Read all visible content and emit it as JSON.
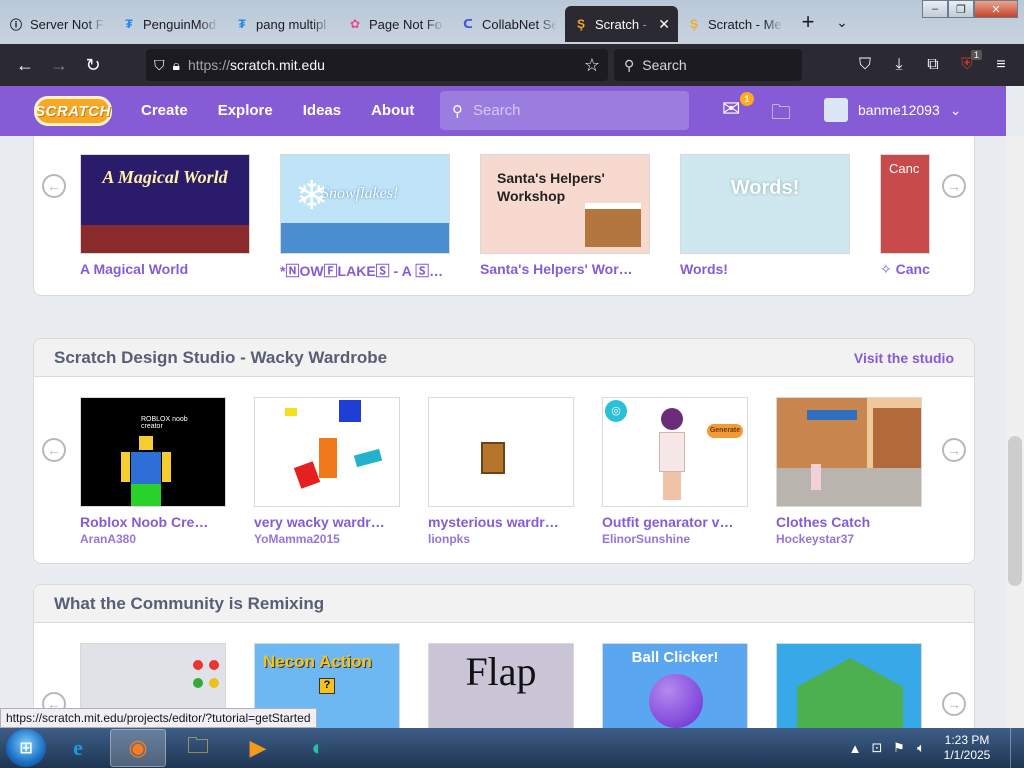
{
  "browser": {
    "tabs": [
      {
        "label": "Server Not Fo",
        "icon": "info-icon",
        "active": false
      },
      {
        "label": "PenguinMod",
        "icon": "penguinmod-icon",
        "active": false
      },
      {
        "label": "pang multipl",
        "icon": "penguinmod-icon",
        "active": false
      },
      {
        "label": "Page Not Fo",
        "icon": "flower-icon",
        "active": false
      },
      {
        "label": "CollabNet Se",
        "icon": "collabnet-icon",
        "active": false
      },
      {
        "label": "Scratch - I",
        "icon": "scratch-cat-icon",
        "active": true
      },
      {
        "label": "Scratch - Me",
        "icon": "scratch-cat-icon",
        "active": false
      }
    ],
    "url": {
      "protocol": "https://",
      "host": "scratch.mit.edu",
      "path": ""
    },
    "search_placeholder": "Search",
    "ublock_badge": "1"
  },
  "header": {
    "logo": "SCRATCH",
    "nav": [
      "Create",
      "Explore",
      "Ideas",
      "About"
    ],
    "search_placeholder": "Search",
    "messages_count": "1",
    "username": "banme12093"
  },
  "sections": [
    {
      "title": "",
      "link": "",
      "cards": [
        {
          "title": "A Magical World",
          "author": "",
          "thumb_text": "A Magical World",
          "bg": "#2a1c6b"
        },
        {
          "title": "*🄽OW🄵LAKE🅂 - A 🅂T…",
          "author": "",
          "thumb_text": "Snowflakes!",
          "bg": "#bfe3f7"
        },
        {
          "title": "Santa's Helpers' Wor…",
          "author": "",
          "thumb_text": "Santa's Helpers' Workshop",
          "bg": "#f8d9d0"
        },
        {
          "title": "Words!",
          "author": "",
          "thumb_text": "Words!",
          "bg": "#cfe8f0"
        },
        {
          "title": "✧ Canc",
          "author": "",
          "thumb_text": "Canc",
          "bg": "#c94a4a"
        }
      ]
    },
    {
      "title": "Scratch Design Studio - Wacky Wardrobe",
      "link": "Visit the studio",
      "cards": [
        {
          "title": "Roblox Noob Cre…",
          "author": "AranA380",
          "thumb_text": "ROBLOX noob creator",
          "bg": "#000000"
        },
        {
          "title": "very wacky wardr…",
          "author": "YoMamma2015",
          "thumb_text": "",
          "bg": "#ffffff"
        },
        {
          "title": "mysterious wardr…",
          "author": "lionpks",
          "thumb_text": "",
          "bg": "#ffffff"
        },
        {
          "title": "Outfit genarator v…",
          "author": "ElinorSunshine",
          "thumb_text": "Generate",
          "bg": "#ffffff"
        },
        {
          "title": "Clothes Catch",
          "author": "Hockeystar37",
          "thumb_text": "",
          "bg": "#e6a36b"
        }
      ]
    },
    {
      "title": "What the Community is Remixing",
      "link": "",
      "cards": [
        {
          "title": "",
          "author": "",
          "thumb_text": "",
          "bg": "#dfe3e8"
        },
        {
          "title": "",
          "author": "",
          "thumb_text": "Necon Action",
          "bg": "#6db7f2"
        },
        {
          "title": "",
          "author": "",
          "thumb_text": "Flap",
          "bg": "#c9c5d6"
        },
        {
          "title": "",
          "author": "",
          "thumb_text": "Ball Clicker!",
          "bg": "#5aa6f0"
        },
        {
          "title": "",
          "author": "",
          "thumb_text": "",
          "bg": "#38a9e8"
        }
      ]
    }
  ],
  "status_url": "https://scratch.mit.edu/projects/editor/?tutorial=getStarted",
  "taskbar": {
    "apps": [
      "internet-explorer-icon",
      "firefox-icon",
      "folder-icon",
      "media-player-icon",
      "edge-icon"
    ],
    "time": "1:23 PM",
    "date": "1/1/2025"
  },
  "colors": {
    "scratch_purple": "#855cd6",
    "browser_dark": "#2b2a33"
  }
}
